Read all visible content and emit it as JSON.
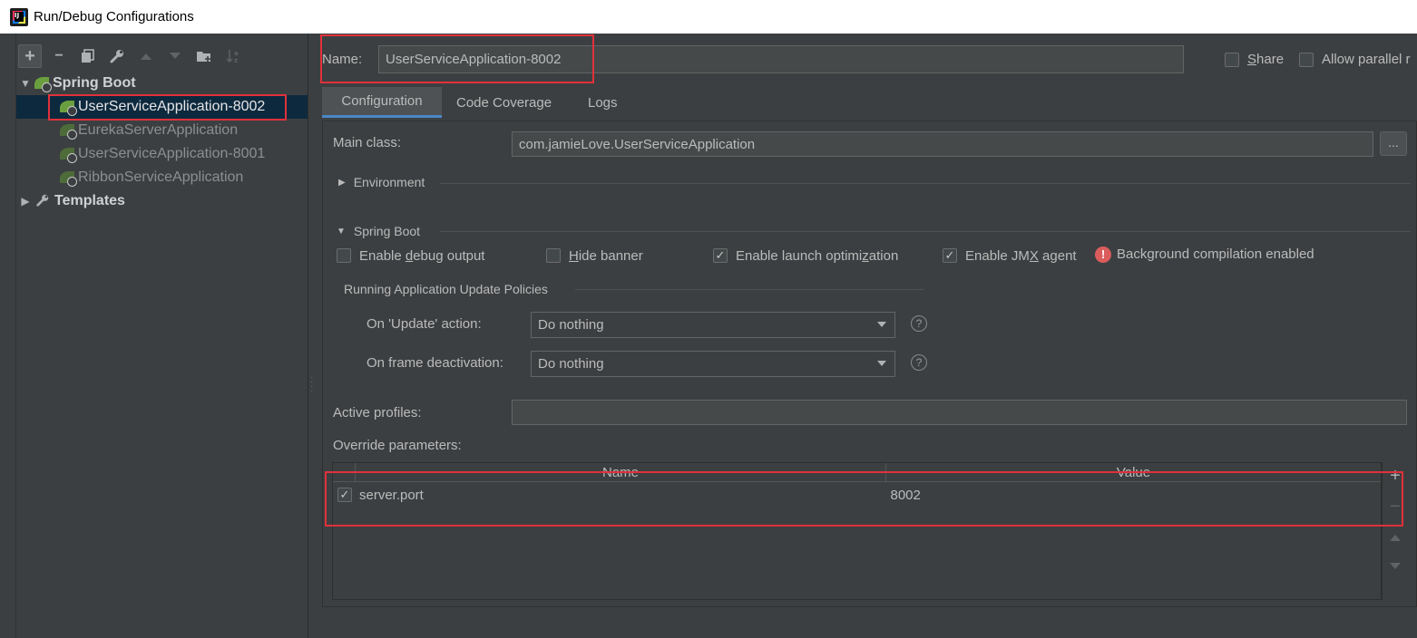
{
  "window": {
    "title": "Run/Debug Configurations"
  },
  "toolbar": {
    "add_icon": "plus-icon",
    "remove_icon": "minus-icon",
    "copy_icon": "copy-icon",
    "edit_icon": "wrench-icon",
    "up_icon": "arrow-up-icon",
    "down_icon": "arrow-down-icon",
    "folder_icon": "new-folder-icon",
    "sort_icon": "sort-icon"
  },
  "tree": {
    "group": "Spring Boot",
    "items": [
      {
        "label": "UserServiceApplication-8002",
        "selected": true
      },
      {
        "label": "EurekaServerApplication",
        "selected": false
      },
      {
        "label": "UserServiceApplication-8001",
        "selected": false
      },
      {
        "label": "RibbonServiceApplication",
        "selected": false
      }
    ],
    "templates": "Templates"
  },
  "header": {
    "name_label": "Name:",
    "name_value": "UserServiceApplication-8002",
    "share_label": "Share",
    "allow_parallel_label": "Allow parallel r"
  },
  "tabs": [
    {
      "label": "Configuration",
      "active": true
    },
    {
      "label": "Code Coverage",
      "active": false
    },
    {
      "label": "Logs",
      "active": false
    }
  ],
  "config": {
    "main_class_label": "Main class:",
    "main_class_value": "com.jamieLove.UserServiceApplication",
    "browse_label": "...",
    "environment_label": "Environment",
    "spring_boot_label": "Spring Boot",
    "options": {
      "debug_output": {
        "pre": "Enable ",
        "u": "d",
        "post": "ebug output",
        "checked": false
      },
      "hide_banner": {
        "pre": "",
        "u": "H",
        "post": "ide banner",
        "checked": false
      },
      "launch_opt": {
        "pre": "Enable launch optimi",
        "u": "z",
        "post": "ation",
        "checked": true
      },
      "jmx_agent": {
        "pre": "Enable JM",
        "u": "X",
        "post": " agent",
        "checked": true
      }
    },
    "bg_compilation": "Background compilation enabled",
    "update_policies_label": "Running Application Update Policies",
    "on_update_label": "On 'Update' action:",
    "on_update_value": "Do nothing",
    "on_frame_label": "On frame deactivation:",
    "on_frame_value": "Do nothing",
    "active_profiles_label": "Active profiles:",
    "active_profiles_value": "",
    "override_label": "Override parameters:",
    "table": {
      "columns": [
        "Name",
        "Value"
      ],
      "rows": [
        {
          "checked": true,
          "name": "server.port",
          "value": "8002"
        }
      ]
    }
  },
  "colors": {
    "accent": "#4a88c7",
    "highlight": "#e0313b",
    "background": "#3c3f41"
  }
}
